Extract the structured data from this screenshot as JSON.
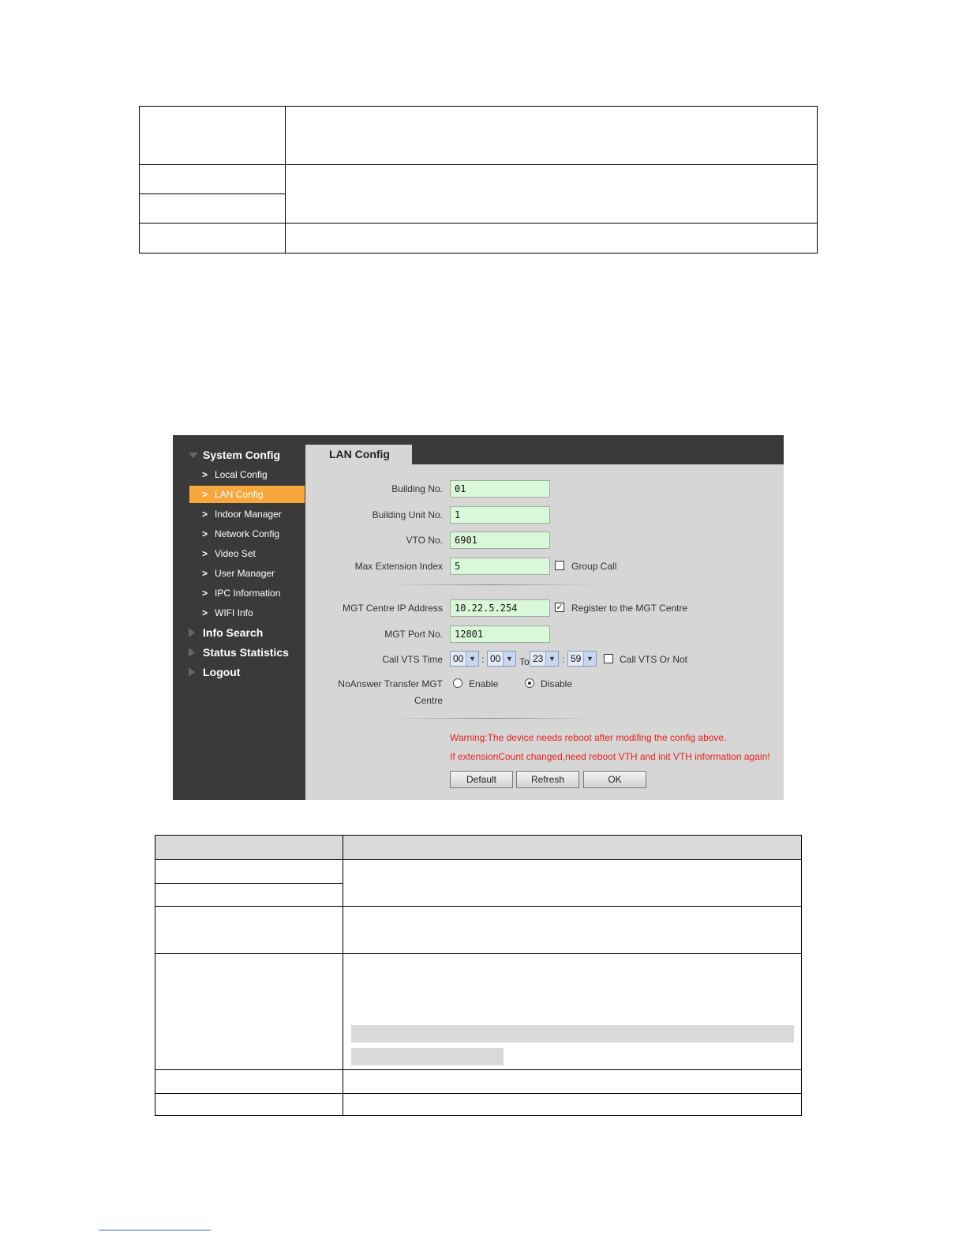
{
  "sidebar": {
    "groups": [
      {
        "label": "System Config"
      },
      {
        "label": "Info Search"
      },
      {
        "label": "Status Statistics"
      },
      {
        "label": "Logout"
      }
    ],
    "items": [
      {
        "label": "Local Config"
      },
      {
        "label": "LAN Config"
      },
      {
        "label": "Indoor Manager"
      },
      {
        "label": "Network Config"
      },
      {
        "label": "Video Set"
      },
      {
        "label": "User Manager"
      },
      {
        "label": "IPC Information"
      },
      {
        "label": "WIFI Info"
      }
    ],
    "active_item": "LAN Config",
    "accent": "#f7a73b"
  },
  "tab": {
    "label": "LAN Config"
  },
  "form": {
    "building_no": {
      "label": "Building No.",
      "value": "01"
    },
    "building_unit_no": {
      "label": "Building Unit No.",
      "value": "1"
    },
    "vto_no": {
      "label": "VTO No.",
      "value": "6901"
    },
    "max_extension_index": {
      "label": "Max Extension Index",
      "value": "5"
    },
    "group_call": {
      "label": "Group Call",
      "checked": false
    },
    "mgt_centre_ip": {
      "label": "MGT Centre IP Address",
      "value": "10.22.5.254"
    },
    "register_mgt": {
      "label": "Register to the MGT Centre",
      "checked": true
    },
    "mgt_port_no": {
      "label": "MGT Port No.",
      "value": "12801"
    },
    "call_vts_time": {
      "label": "Call VTS Time",
      "start_hour": "00",
      "start_min": "00",
      "to_label": "To",
      "end_hour": "23",
      "end_min": "59",
      "sep": ":"
    },
    "call_vts_or_not": {
      "label": "Call VTS Or Not",
      "checked": false
    },
    "noanswer_transfer": {
      "label_line1": "NoAnswer Transfer MGT",
      "label_line2": "Centre",
      "enable_label": "Enable",
      "disable_label": "Disable",
      "selected": "Disable"
    }
  },
  "warnings": {
    "line1": "Warning:The device needs reboot after modifing the config above.",
    "line2": "If extensionCount changed,need reboot VTH and init VTH information again!",
    "color": "#e8211c"
  },
  "buttons": {
    "default_label": "Default",
    "refresh_label": "Refresh",
    "ok_label": "OK"
  }
}
